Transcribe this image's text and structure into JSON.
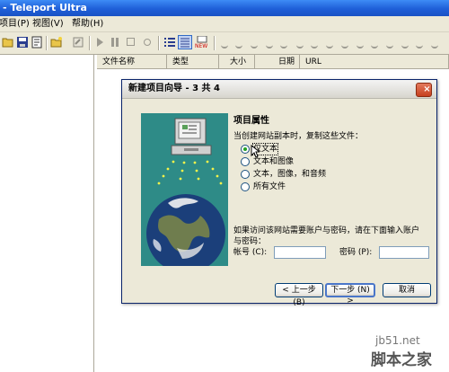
{
  "window": {
    "title": "- Teleport Ultra"
  },
  "menu": {
    "items": [
      "项目(P)",
      "视图(V)",
      "帮助(H)"
    ]
  },
  "list": {
    "columns": [
      "文件名称",
      "类型",
      "大小",
      "日期",
      "URL"
    ]
  },
  "dialog": {
    "title": "新建项目向导 - 3 共 4",
    "close_label": "×",
    "heading": "项目属性",
    "prompt": "当创建网站副本时，复制这些文件：",
    "options": [
      "仅文本",
      "文本和图像",
      "文本，图像，和音频",
      "所有文件"
    ],
    "selected_option": "仅文本",
    "auth_text_line1": "如果访问该网站需要账户与密码，请在下面输入账户",
    "auth_text_line2": "与密码：",
    "account_label": "帐号 (C):",
    "account_value": "",
    "password_label": "密码 (P):",
    "password_value": "",
    "back_label": "< 上一步 (B)",
    "next_label": "下一步 (N) >",
    "cancel_label": "取消"
  },
  "watermark": {
    "url": "jb51.net",
    "site": "脚本之家"
  },
  "colors": {
    "titlebar": "#1f5fd8",
    "dialog_bg": "#ece9d8",
    "illustration_bg": "#2e8b87",
    "radio_dot": "#21a121"
  }
}
